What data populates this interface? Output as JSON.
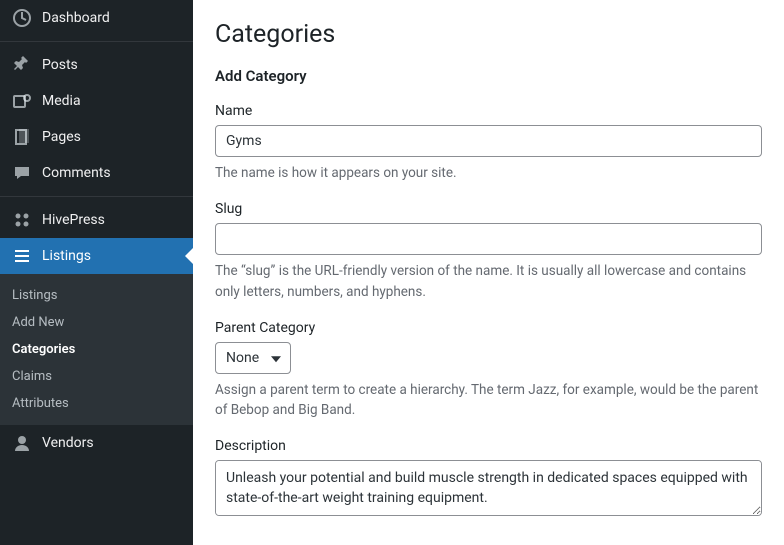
{
  "sidebar": {
    "dashboard": "Dashboard",
    "posts": "Posts",
    "media": "Media",
    "pages": "Pages",
    "comments": "Comments",
    "hivepress": "HivePress",
    "listings": "Listings",
    "vendors": "Vendors"
  },
  "submenu": {
    "listings": "Listings",
    "add_new": "Add New",
    "categories": "Categories",
    "claims": "Claims",
    "attributes": "Attributes"
  },
  "page": {
    "title": "Categories",
    "form_title": "Add Category"
  },
  "form": {
    "name": {
      "label": "Name",
      "value": "Gyms",
      "help": "The name is how it appears on your site."
    },
    "slug": {
      "label": "Slug",
      "value": "",
      "help": "The “slug” is the URL-friendly version of the name. It is usually all lowercase and contains only letters, numbers, and hyphens."
    },
    "parent": {
      "label": "Parent Category",
      "value": "None",
      "help": "Assign a parent term to create a hierarchy. The term Jazz, for example, would be the parent of Bebop and Big Band."
    },
    "description": {
      "label": "Description",
      "value": "Unleash your potential and build muscle strength in dedicated spaces equipped with state-of-the-art weight training equipment."
    }
  }
}
